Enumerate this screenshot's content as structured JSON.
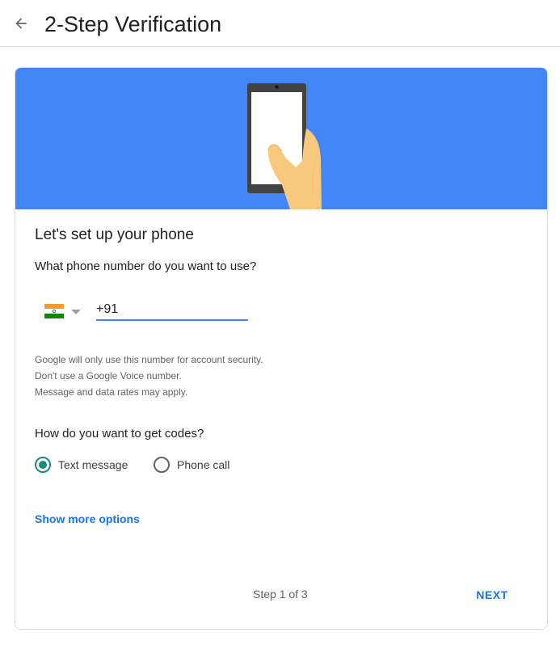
{
  "header": {
    "title": "2-Step Verification"
  },
  "card": {
    "title": "Let's set up your phone",
    "phone_question": "What phone number do you want to use?",
    "phone_input": {
      "country": "India",
      "value": "+91"
    },
    "notes": [
      "Google will only use this number for account security.",
      "Don't use a Google Voice number.",
      "Message and data rates may apply."
    ],
    "codes_question": "How do you want to get codes?",
    "options": [
      {
        "label": "Text message",
        "selected": true
      },
      {
        "label": "Phone call",
        "selected": false
      }
    ],
    "more_options_link": "Show more options",
    "step_text": "Step 1 of 3",
    "next_label": "NEXT"
  },
  "colors": {
    "banner": "#4285f4",
    "link": "#1a73e8",
    "radio_selected": "#1a8a7b",
    "input_underline": "#4285f4"
  }
}
